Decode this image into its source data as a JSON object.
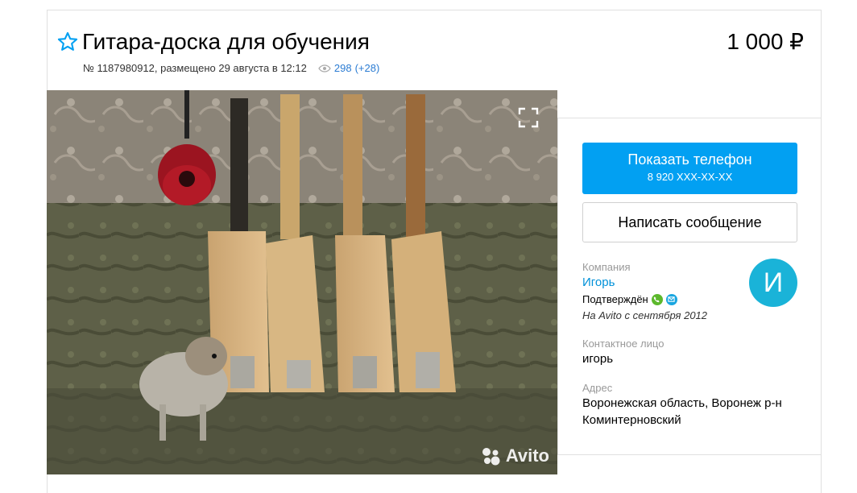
{
  "listing": {
    "title": "Гитара-доска для обучения",
    "price": "1 000 ₽",
    "number_and_date": "№ 1187980912, размещено 29 августа в 12:12",
    "views": "298",
    "views_delta": "(+28)"
  },
  "photo": {
    "watermark": "Avito",
    "icons": {
      "expand": "expand-icon",
      "favorite": "star-outline-icon",
      "views": "eye-icon"
    }
  },
  "contact": {
    "show_phone_label": "Показать телефон",
    "phone_masked": "8 920 XXX-XX-XX",
    "message_label": "Написать сообщение"
  },
  "seller": {
    "company_label": "Компания",
    "name": "Игорь",
    "verified_label": "Подтверждён",
    "since": "На Avito с сентября 2012",
    "avatar_letter": "И",
    "contact_person_label": "Контактное лицо",
    "contact_person": "игорь",
    "address_label": "Адрес",
    "address_line1": "Воронежская область, Воронеж р-н",
    "address_line2": "Коминтерновский"
  },
  "colors": {
    "accent": "#02a0f2",
    "link": "#0091d9",
    "avatar": "#1ab3d8"
  }
}
